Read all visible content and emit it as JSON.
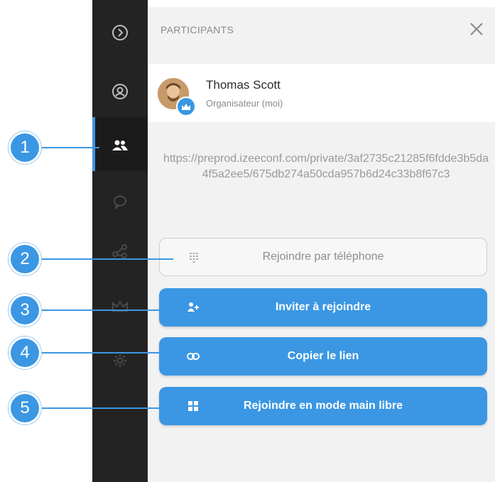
{
  "colors": {
    "accent": "#3b97e3",
    "rail": "#232323",
    "panel": "#f2f2f2"
  },
  "sidebar": {
    "icons": [
      {
        "name": "expand-chevron-icon"
      },
      {
        "name": "profile-icon"
      },
      {
        "name": "participants-icon",
        "active": true
      },
      {
        "name": "chat-icon"
      },
      {
        "name": "share-icon"
      },
      {
        "name": "crown-icon"
      },
      {
        "name": "settings-icon"
      }
    ]
  },
  "panel": {
    "title": "PARTICIPANTS",
    "close_icon": "close-icon",
    "participant": {
      "name": "Thomas Scott",
      "role": "Organisateur (moi)",
      "badge_icon": "crown-icon"
    },
    "link": "https://preprod.izeeconf.com/private/3af2735c21285f6fdde3b5da4f5a2ee5/675db274a50cda957b6d24c33b8f67c3",
    "buttons": [
      {
        "label": "Rejoindre par téléphone",
        "icon": "keypad-icon",
        "style": "outline"
      },
      {
        "label": "Inviter à rejoindre",
        "icon": "invite-icon",
        "style": "primary"
      },
      {
        "label": "Copier le lien",
        "icon": "link-icon",
        "style": "primary"
      },
      {
        "label": "Rejoindre en mode main libre",
        "icon": "grid-icon",
        "style": "primary"
      }
    ]
  },
  "callouts": [
    "1",
    "2",
    "3",
    "4",
    "5"
  ]
}
